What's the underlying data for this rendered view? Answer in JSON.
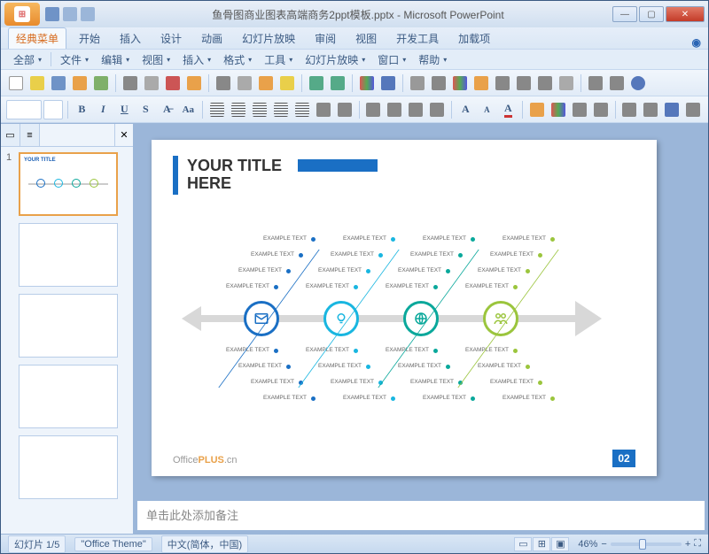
{
  "window": {
    "title": "鱼骨图商业图表高端商务2ppt模板.pptx - Microsoft PowerPoint"
  },
  "tabs": {
    "classic": "经典菜单",
    "home": "开始",
    "insert": "插入",
    "design": "设计",
    "animations": "动画",
    "slideshow": "幻灯片放映",
    "review": "审阅",
    "view": "视图",
    "developer": "开发工具",
    "addins": "加载项"
  },
  "menu": {
    "all": "全部",
    "file": "文件",
    "edit": "编辑",
    "view": "视图",
    "insert": "插入",
    "format": "格式",
    "tools": "工具",
    "slideshow": "幻灯片放映",
    "window": "窗口",
    "help": "帮助"
  },
  "slide": {
    "title_line1": "YOUR TITLE",
    "title_line2": "HERE",
    "example": "EXAMPLE TEXT",
    "logo_prefix": "Office",
    "logo_plus": "PLUS",
    "logo_suffix": ".cn",
    "page": "02"
  },
  "notes": {
    "placeholder": "单击此处添加备注"
  },
  "status": {
    "slide": "幻灯片 1/5",
    "theme": "\"Office Theme\"",
    "lang": "中文(简体，中国)",
    "zoom": "46%"
  },
  "thumb": {
    "num": "1",
    "title": "YOUR TITLE"
  }
}
